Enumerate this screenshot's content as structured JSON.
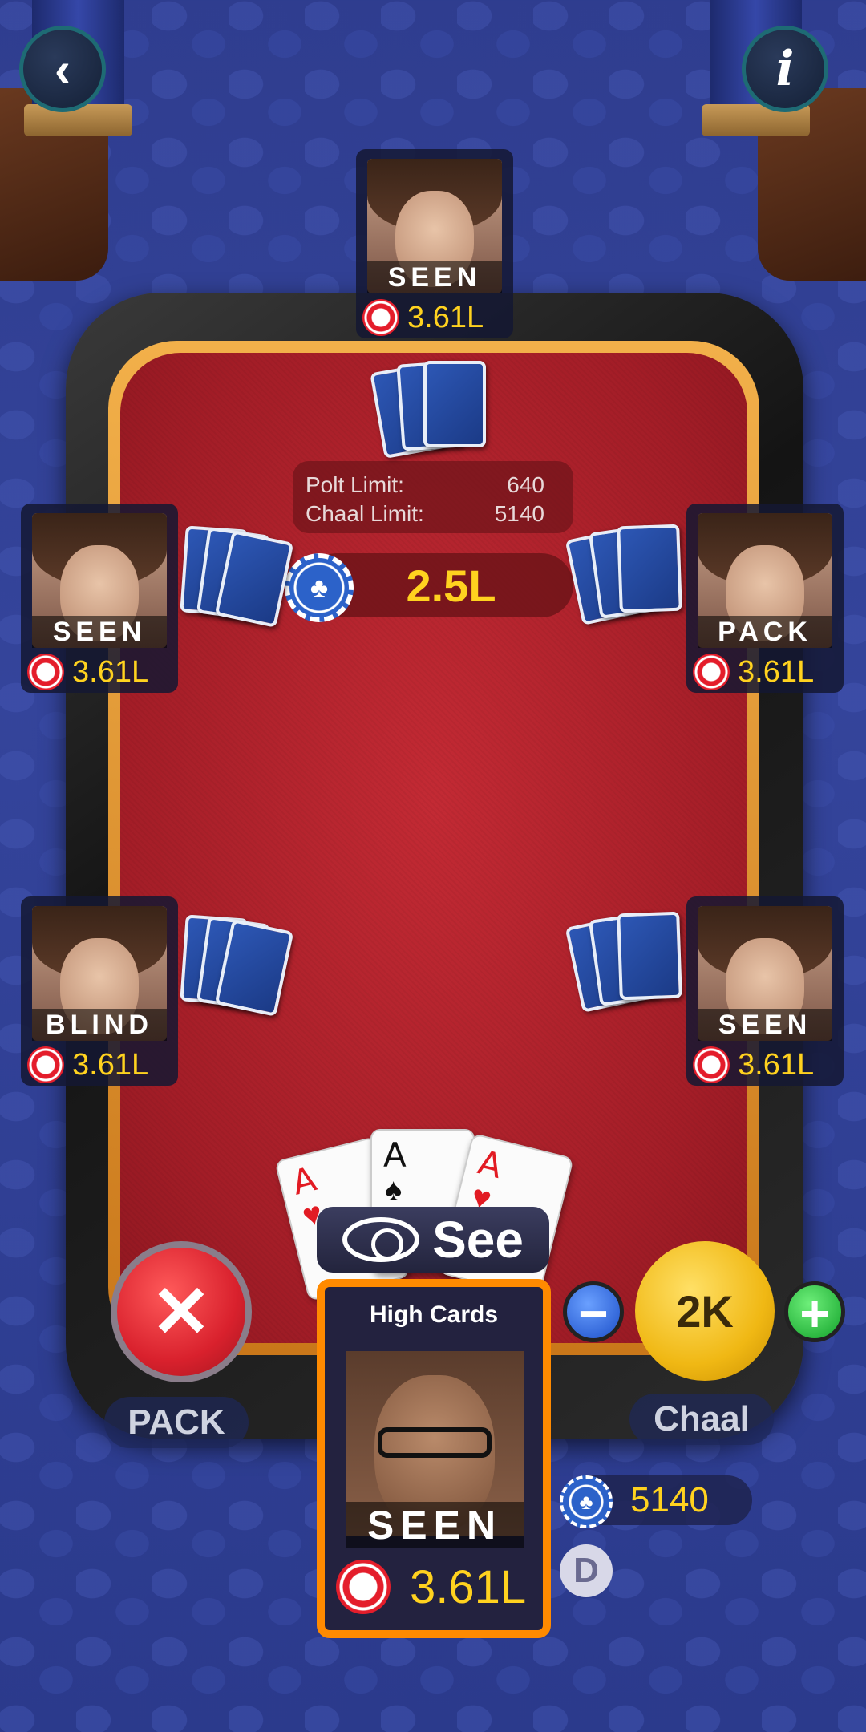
{
  "limits": {
    "polt_label": "Polt Limit:",
    "polt_value": "640",
    "chaal_label": "Chaal Limit:",
    "chaal_value": "5140"
  },
  "pot": {
    "amount": "2.5L"
  },
  "players": [
    {
      "id": "top",
      "status": "SEEN",
      "amount": "3.61L"
    },
    {
      "id": "left-upper",
      "status": "SEEN",
      "amount": "3.61L"
    },
    {
      "id": "right-upper",
      "status": "PACK",
      "amount": "3.61L"
    },
    {
      "id": "left-lower",
      "status": "BLIND",
      "amount": "3.61L"
    },
    {
      "id": "right-lower",
      "status": "SEEN",
      "amount": "3.61L"
    }
  ],
  "me": {
    "hand_name": "High Cards",
    "status": "SEEN",
    "amount": "3.61L",
    "cards": [
      {
        "rank": "A",
        "suit": "♥",
        "color": "red"
      },
      {
        "rank": "A",
        "suit": "♠",
        "color": "black"
      },
      {
        "rank": "A",
        "suit": "♥",
        "color": "red"
      }
    ]
  },
  "controls": {
    "back_icon": "‹",
    "info_icon": "i",
    "see_label": "See",
    "pack_symbol": "✕",
    "pack_label": "PACK",
    "chaal_amount": "2K",
    "chaal_label": "Chaal",
    "minus": "−",
    "plus": "+",
    "bet_value": "5140",
    "dealer": "D",
    "chip_symbol": "♣"
  }
}
